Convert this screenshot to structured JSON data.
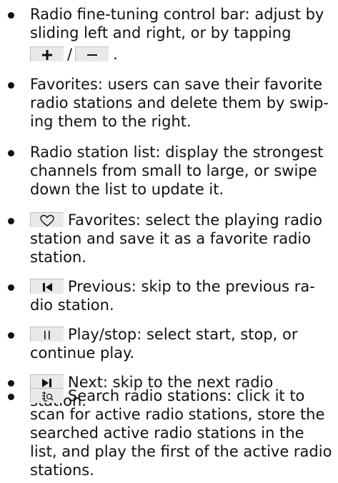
{
  "items": [
    {
      "lines": [
        "Radio fine-tuning control bar: adjust by",
        "sliding left and right, or by tapping"
      ],
      "tail_sep": "/",
      "tail_end": "."
    },
    {
      "lines": [
        "Favorites: users can save their favorite",
        "radio stations and delete them by swip-",
        "ing them to the right."
      ]
    },
    {
      "lines": [
        "Radio station list: display the strongest",
        "channels from small to large, or swipe",
        "down the list to update it."
      ]
    },
    {
      "icon": "heart-outline-icon",
      "lines": [
        "Favorites: select the playing radio",
        "station and save it as a favorite radio",
        "station."
      ]
    },
    {
      "icon": "skip-previous-icon",
      "lines": [
        "Previous: skip to the previous ra-",
        "dio station."
      ]
    },
    {
      "icon": "pause-icon",
      "lines": [
        "Play/stop: select start, stop, or",
        "continue play."
      ]
    },
    {
      "icon": "skip-next-icon",
      "lines": [
        "Next: skip to the next radio",
        "station."
      ]
    },
    {
      "icon": "search-list-icon",
      "lines": [
        "Search radio stations: click it to",
        "scan for active radio stations, store the",
        "searched active radio stations in the",
        "list, and play the first of the active radio",
        "stations."
      ]
    }
  ],
  "colors": {
    "text": "#111111",
    "key_bg": "#e9e9e9",
    "key_border": "#bdbdbd"
  }
}
